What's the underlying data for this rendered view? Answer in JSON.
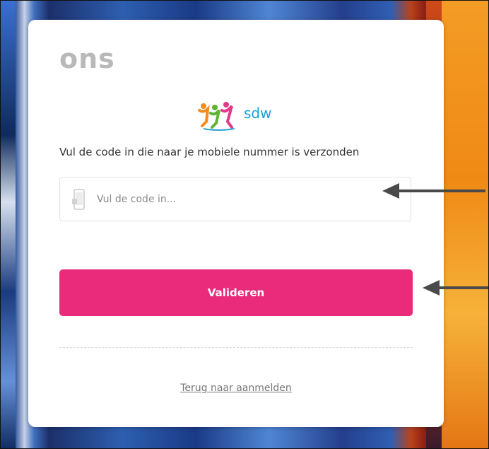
{
  "brand": {
    "ons_logo": "ons",
    "partner_logo_text": "sdw"
  },
  "form": {
    "instruction": "Vul de code in die naar je mobiele nummer is verzonden",
    "code_input": {
      "placeholder": "Vul de code in...",
      "value": ""
    },
    "submit_label": "Valideren",
    "back_link": "Terug naar aanmelden"
  },
  "icons": {
    "phone": "mobile-phone-icon",
    "annotation_arrow": "left-arrow-icon"
  },
  "colors": {
    "accent": "#ea2a7b",
    "partner_blue": "#1a9fd8",
    "logo_gray": "#b9b9b9"
  }
}
